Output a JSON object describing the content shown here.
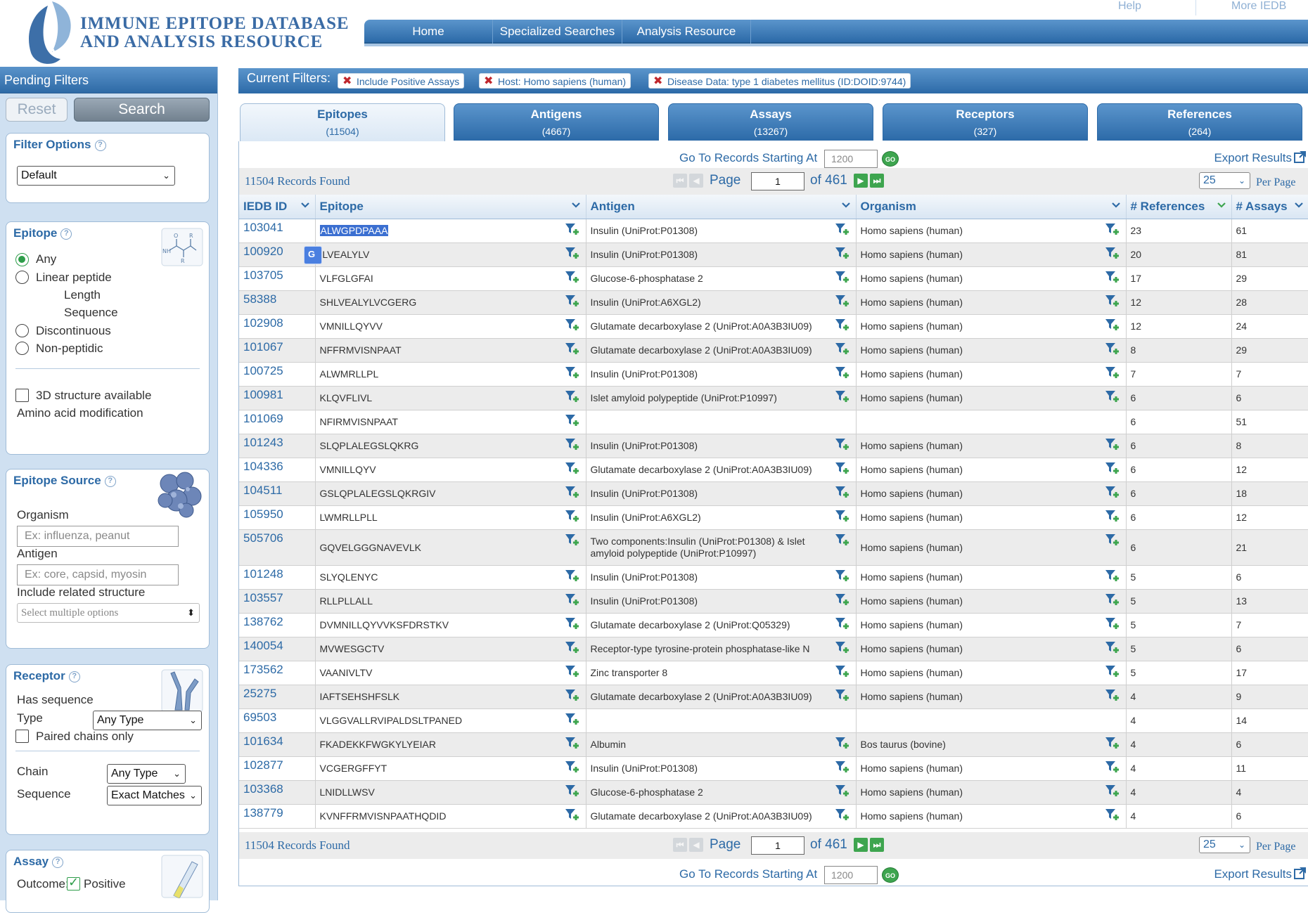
{
  "header": {
    "logo_line1": "IMMUNE EPITOPE DATABASE",
    "logo_line2": "AND ANALYSIS RESOURCE",
    "help_link": "Help",
    "more_link": "More IEDB",
    "nav": [
      "Home",
      "Specialized Searches",
      "Analysis Resource"
    ]
  },
  "sidebar": {
    "title": "Pending Filters",
    "reset_label": "Reset",
    "search_label": "Search",
    "filter_options": {
      "title": "Filter Options",
      "help": "?",
      "selected": "Default"
    },
    "epitope": {
      "title": "Epitope",
      "help": "?",
      "any": "Any",
      "linear": "Linear peptide",
      "length": "Length",
      "sequence": "Sequence",
      "discontinuous": "Discontinuous",
      "nonpeptidic": "Non-peptidic",
      "structure": "3D structure available",
      "modification": "Amino acid modification"
    },
    "epitope_source": {
      "title": "Epitope Source",
      "help": "?",
      "organism_label": "Organism",
      "organism_placeholder": "Ex: influenza, peanut",
      "antigen_label": "Antigen",
      "antigen_placeholder": "Ex: core, capsid, myosin",
      "related_label": "Include related structure",
      "related_select": "Select multiple options"
    },
    "receptor": {
      "title": "Receptor",
      "help": "?",
      "has_sequence": "Has sequence",
      "type_label": "Type",
      "type_value": "Any Type",
      "paired": "Paired chains only",
      "chain_label": "Chain",
      "chain_value": "Any Type",
      "sequence_label": "Sequence",
      "sequence_value": "Exact Matches"
    },
    "assay": {
      "title": "Assay",
      "help": "?",
      "outcome_label": "Outcome:",
      "positive_label": "Positive"
    }
  },
  "filters": {
    "label": "Current Filters:",
    "chips": [
      "Include Positive Assays",
      "Host: Homo sapiens (human)",
      "Disease Data: type 1 diabetes mellitus (ID:DOID:9744)"
    ]
  },
  "tabs": [
    {
      "label": "Epitopes",
      "count": "(11504)"
    },
    {
      "label": "Antigens",
      "count": "(4667)"
    },
    {
      "label": "Assays",
      "count": "(13267)"
    },
    {
      "label": "Receptors",
      "count": "(327)"
    },
    {
      "label": "References",
      "count": "(264)"
    }
  ],
  "results": {
    "goto_label": "Go To Records Starting At",
    "goto_placeholder": "1200",
    "go_label": "GO",
    "export_label": "Export Results",
    "records_found": "11504 Records Found",
    "page_label": "Page",
    "page_value": "1",
    "of_label": "of 461",
    "per_page_value": "25",
    "per_page_label": "Per Page",
    "columns": [
      "IEDB ID",
      "Epitope",
      "Antigen",
      "Organism",
      "# References",
      "# Assays"
    ],
    "rows": [
      {
        "id": "103041",
        "epitope": "ALWGPDPAAA",
        "antigen": "Insulin (UniProt:P01308)",
        "organism": "Homo sapiens (human)",
        "refs": "23",
        "assays": "61"
      },
      {
        "id": "100920",
        "epitope": "ILVEALYLV",
        "antigen": "Insulin (UniProt:P01308)",
        "organism": "Homo sapiens (human)",
        "refs": "20",
        "assays": "81"
      },
      {
        "id": "103705",
        "epitope": "VLFGLGFAI",
        "antigen": "Glucose-6-phosphatase 2",
        "organism": "Homo sapiens (human)",
        "refs": "17",
        "assays": "29"
      },
      {
        "id": "58388",
        "epitope": "SHLVEALYLVCGERG",
        "antigen": "Insulin (UniProt:A6XGL2)",
        "organism": "Homo sapiens (human)",
        "refs": "12",
        "assays": "28"
      },
      {
        "id": "102908",
        "epitope": "VMNILLQYVV",
        "antigen": "Glutamate decarboxylase 2 (UniProt:A0A3B3IU09)",
        "organism": "Homo sapiens (human)",
        "refs": "12",
        "assays": "24"
      },
      {
        "id": "101067",
        "epitope": "NFFRMVISNPAAT",
        "antigen": "Glutamate decarboxylase 2 (UniProt:A0A3B3IU09)",
        "organism": "Homo sapiens (human)",
        "refs": "8",
        "assays": "29"
      },
      {
        "id": "100725",
        "epitope": "ALWMRLLPL",
        "antigen": "Insulin (UniProt:P01308)",
        "organism": "Homo sapiens (human)",
        "refs": "7",
        "assays": "7"
      },
      {
        "id": "100981",
        "epitope": "KLQVFLIVL",
        "antigen": "Islet amyloid polypeptide (UniProt:P10997)",
        "organism": "Homo sapiens (human)",
        "refs": "6",
        "assays": "6"
      },
      {
        "id": "101069",
        "epitope": "NFIRMVISNPAAT",
        "antigen": "",
        "organism": "",
        "refs": "6",
        "assays": "51"
      },
      {
        "id": "101243",
        "epitope": "SLQPLALEGSLQKRG",
        "antigen": "Insulin (UniProt:P01308)",
        "organism": "Homo sapiens (human)",
        "refs": "6",
        "assays": "8"
      },
      {
        "id": "104336",
        "epitope": "VMNILLQYV",
        "antigen": "Glutamate decarboxylase 2 (UniProt:A0A3B3IU09)",
        "organism": "Homo sapiens (human)",
        "refs": "6",
        "assays": "12"
      },
      {
        "id": "104511",
        "epitope": "GSLQPLALEGSLQKRGIV",
        "antigen": "Insulin (UniProt:P01308)",
        "organism": "Homo sapiens (human)",
        "refs": "6",
        "assays": "18"
      },
      {
        "id": "105950",
        "epitope": "LWMRLLPLL",
        "antigen": "Insulin (UniProt:A6XGL2)",
        "organism": "Homo sapiens (human)",
        "refs": "6",
        "assays": "12"
      },
      {
        "id": "505706",
        "epitope": "GQVELGGGNAVEVLK",
        "antigen": "Two components:Insulin (UniProt:P01308) & Islet amyloid polypeptide (UniProt:P10997)",
        "organism": "Homo sapiens (human)",
        "refs": "6",
        "assays": "21"
      },
      {
        "id": "101248",
        "epitope": "SLYQLENYC",
        "antigen": "Insulin (UniProt:P01308)",
        "organism": "Homo sapiens (human)",
        "refs": "5",
        "assays": "6"
      },
      {
        "id": "103557",
        "epitope": "RLLPLLALL",
        "antigen": "Insulin (UniProt:P01308)",
        "organism": "Homo sapiens (human)",
        "refs": "5",
        "assays": "13"
      },
      {
        "id": "138762",
        "epitope": "DVMNILLQYVVKSFDRSTKV",
        "antigen": "Glutamate decarboxylase 2 (UniProt:Q05329)",
        "organism": "Homo sapiens (human)",
        "refs": "5",
        "assays": "7"
      },
      {
        "id": "140054",
        "epitope": "MVWESGCTV",
        "antigen": "Receptor-type tyrosine-protein phosphatase-like N",
        "organism": "Homo sapiens (human)",
        "refs": "5",
        "assays": "6"
      },
      {
        "id": "173562",
        "epitope": "VAANIVLTV",
        "antigen": "Zinc transporter 8",
        "organism": "Homo sapiens (human)",
        "refs": "5",
        "assays": "17"
      },
      {
        "id": "25275",
        "epitope": "IAFTSEHSHFSLK",
        "antigen": "Glutamate decarboxylase 2 (UniProt:A0A3B3IU09)",
        "organism": "Homo sapiens (human)",
        "refs": "4",
        "assays": "9"
      },
      {
        "id": "69503",
        "epitope": "VLGGVALLRVIPALDSLTPANED",
        "antigen": "",
        "organism": "",
        "refs": "4",
        "assays": "14"
      },
      {
        "id": "101634",
        "epitope": "FKADEKKFWGKYLYEIAR",
        "antigen": "Albumin",
        "organism": "Bos taurus (bovine)",
        "refs": "4",
        "assays": "6"
      },
      {
        "id": "102877",
        "epitope": "VCGERGFFYT",
        "antigen": "Insulin (UniProt:P01308)",
        "organism": "Homo sapiens (human)",
        "refs": "4",
        "assays": "11"
      },
      {
        "id": "103368",
        "epitope": "LNIDLLWSV",
        "antigen": "Glucose-6-phosphatase 2",
        "organism": "Homo sapiens (human)",
        "refs": "4",
        "assays": "4"
      },
      {
        "id": "138779",
        "epitope": "KVNFFRMVISNPAATHQDID",
        "antigen": "Glutamate decarboxylase 2 (UniProt:A0A3B3IU09)",
        "organism": "Homo sapiens (human)",
        "refs": "4",
        "assays": "6"
      }
    ]
  },
  "colors": {
    "brand_blue": "#2c6aa8",
    "link_blue": "#2d6aa6",
    "go_green": "#3ea54f",
    "remove_red": "#c0272d",
    "selection": "#3b6fd1"
  }
}
